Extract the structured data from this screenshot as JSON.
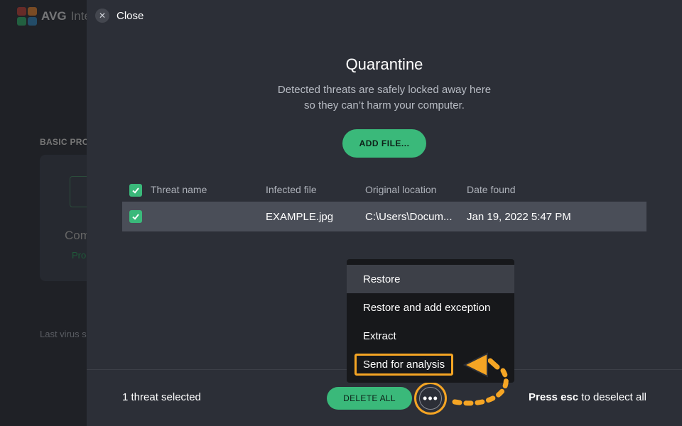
{
  "background_app": {
    "logo_text": "AVG",
    "logo_sub": "Inte",
    "section_label": "BASIC PRO",
    "card_title": "Com",
    "card_status": "Pro",
    "last_scan": "Last virus s"
  },
  "header": {
    "close_label": "Close",
    "close_icon": "x-icon"
  },
  "quarantine": {
    "title": "Quarantine",
    "description_line1": "Detected threats are safely locked away here",
    "description_line2": "so they can’t harm your computer.",
    "add_file_label": "ADD FILE..."
  },
  "table": {
    "columns": [
      "Threat name",
      "Infected file",
      "Original location",
      "Date found"
    ],
    "rows": [
      {
        "threat_name": "",
        "infected_file": "EXAMPLE.jpg",
        "original_location": "C:\\Users\\Docum...",
        "date_found": "Jan 19, 2022 5:47 PM",
        "checked": true
      }
    ],
    "header_checked": true
  },
  "context_menu": {
    "items": [
      "Restore",
      "Restore and add exception",
      "Extract",
      "Send for analysis"
    ],
    "hovered_index": 0,
    "highlighted_index": 3
  },
  "footer": {
    "selection_text": "1 threat selected",
    "delete_all_label": "DELETE ALL",
    "more_icon": "more-options-icon",
    "esc_bold": "Press esc",
    "esc_rest": " to deselect all"
  },
  "colors": {
    "accent_green": "#3ab97a",
    "highlight_orange": "#f5a524",
    "panel_bg": "#2c2f37",
    "menu_bg": "#17181b"
  }
}
